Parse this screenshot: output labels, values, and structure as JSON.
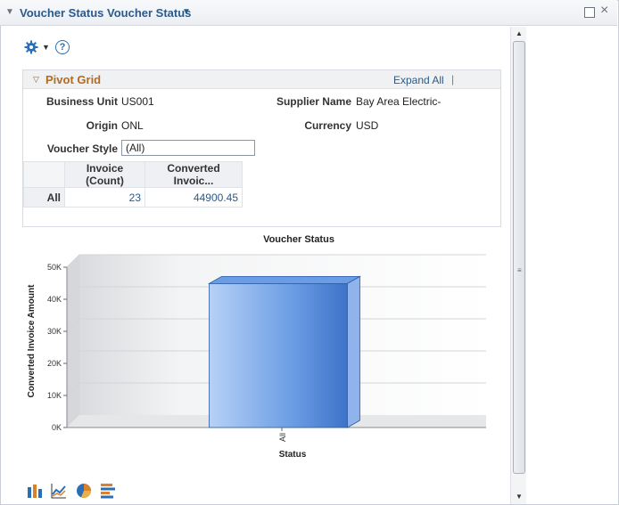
{
  "window": {
    "title": "Voucher Status Voucher Status"
  },
  "pivot": {
    "title": "Pivot Grid",
    "expand_all": "Expand All",
    "separator": "|",
    "fields": {
      "business_unit_label": "Business Unit",
      "business_unit_value": "US001",
      "supplier_name_label": "Supplier Name",
      "supplier_name_value": "Bay Area Electric-",
      "origin_label": "Origin",
      "origin_value": "ONL",
      "currency_label": "Currency",
      "currency_value": "USD",
      "voucher_style_label": "Voucher Style",
      "voucher_style_value": "(All)"
    },
    "grid": {
      "columns": [
        "Invoice (Count)",
        "Converted Invoic..."
      ],
      "rows": [
        {
          "label": "All",
          "cells": [
            "23",
            "44900.45"
          ]
        }
      ]
    }
  },
  "chart_data": {
    "type": "bar",
    "title": "Voucher Status",
    "xlabel": "Status",
    "ylabel": "Converted Invoice Amount",
    "categories": [
      "All"
    ],
    "values": [
      44900.45
    ],
    "ylim": [
      0,
      50000
    ],
    "yticks": [
      "0K",
      "10K",
      "20K",
      "30K",
      "40K",
      "50K"
    ],
    "grid": true,
    "bar_color": "#4f86d9"
  },
  "icons": {
    "toolbar": [
      "gear-icon",
      "help-icon"
    ],
    "chart_types": [
      "bar-chart-icon",
      "line-chart-icon",
      "pie-chart-icon",
      "horizontal-bar-chart-icon"
    ]
  },
  "colors": {
    "title": "#2a5a8c",
    "pivot_title": "#b36b1f",
    "link": "#2a5a8c"
  }
}
